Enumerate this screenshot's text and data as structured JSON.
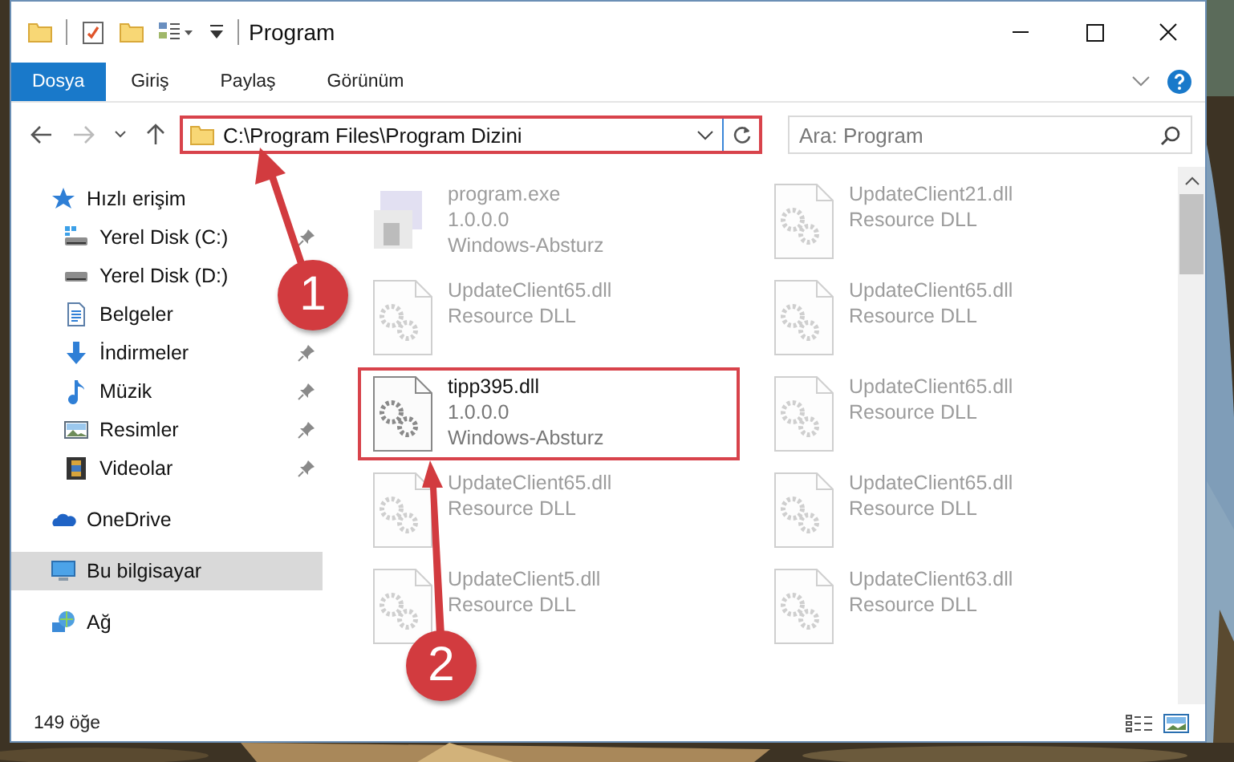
{
  "window": {
    "title": "Program"
  },
  "ribbon_tabs": [
    {
      "label": "Dosya",
      "selected": true
    },
    {
      "label": "Giriş",
      "selected": false
    },
    {
      "label": "Paylaş",
      "selected": false
    },
    {
      "label": "Görünüm",
      "selected": false
    }
  ],
  "address": {
    "path": "C:\\Program Files\\Program Dizini",
    "highlighted": true
  },
  "search": {
    "placeholder": "Ara: Program"
  },
  "nav_pane": {
    "items": [
      {
        "label": "Hızlı erişim",
        "kind": "star",
        "selected": false,
        "children": [
          {
            "label": "Yerel Disk (C:)",
            "kind": "drive-c",
            "pinned": true,
            "selected": false
          },
          {
            "label": "Yerel Disk (D:)",
            "kind": "drive",
            "pinned": false,
            "selected": false
          },
          {
            "label": "Belgeler",
            "kind": "documents",
            "pinned": false,
            "selected": false
          },
          {
            "label": "İndirmeler",
            "kind": "download",
            "pinned": true,
            "selected": false
          },
          {
            "label": "Müzik",
            "kind": "music",
            "pinned": true,
            "selected": false
          },
          {
            "label": "Resimler",
            "kind": "pictures",
            "pinned": true,
            "selected": false
          },
          {
            "label": "Videolar",
            "kind": "videos",
            "pinned": true,
            "selected": false
          }
        ]
      },
      {
        "label": "OneDrive",
        "kind": "cloud",
        "selected": false
      },
      {
        "label": "Bu bilgisayar",
        "kind": "computer",
        "selected": true
      },
      {
        "label": "Ağ",
        "kind": "network",
        "selected": false
      }
    ]
  },
  "files": [
    {
      "name": "program.exe",
      "details": [
        "1.0.0.0",
        "Windows-Absturz"
      ],
      "kind": "exe",
      "faded": true,
      "highlighted": false
    },
    {
      "name": "UpdateClient21.dll",
      "details": [
        "Resource DLL"
      ],
      "kind": "dll",
      "faded": true,
      "highlighted": false
    },
    {
      "name": "UpdateClient65.dll",
      "details": [
        "Resource DLL"
      ],
      "kind": "dll",
      "faded": true,
      "highlighted": false
    },
    {
      "name": "UpdateClient65.dll",
      "details": [
        "Resource DLL"
      ],
      "kind": "dll",
      "faded": true,
      "highlighted": false
    },
    {
      "name": "tipp395.dll",
      "details": [
        "1.0.0.0",
        "Windows-Absturz"
      ],
      "kind": "dll",
      "faded": false,
      "highlighted": true
    },
    {
      "name": "UpdateClient65.dll",
      "details": [
        "Resource DLL"
      ],
      "kind": "dll",
      "faded": true,
      "highlighted": false
    },
    {
      "name": "UpdateClient65.dll",
      "details": [
        "Resource DLL"
      ],
      "kind": "dll",
      "faded": true,
      "highlighted": false
    },
    {
      "name": "UpdateClient65.dll",
      "details": [
        "Resource DLL"
      ],
      "kind": "dll",
      "faded": true,
      "highlighted": false
    },
    {
      "name": "UpdateClient5.dll",
      "details": [
        "Resource DLL"
      ],
      "kind": "dll",
      "faded": true,
      "highlighted": false
    },
    {
      "name": "UpdateClient63.dll",
      "details": [
        "Resource DLL"
      ],
      "kind": "dll",
      "faded": true,
      "highlighted": false
    }
  ],
  "status_bar": {
    "count": "149 öğe"
  },
  "annotations": [
    {
      "label": "1"
    },
    {
      "label": "2"
    }
  ]
}
